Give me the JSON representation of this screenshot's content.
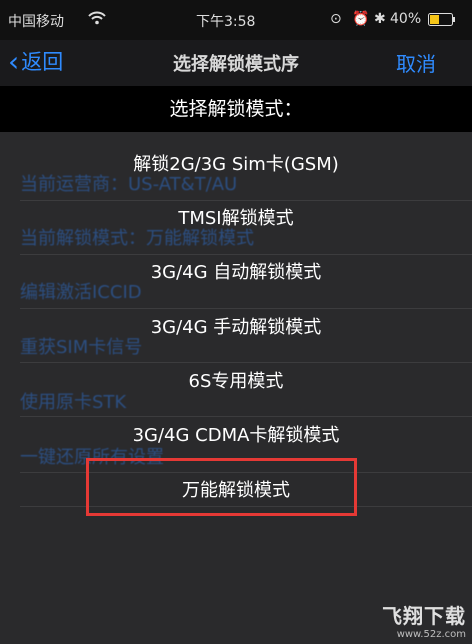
{
  "status_bar": {
    "carrier": "中国移动",
    "wifi_icon": "wifi-icon",
    "time": "下午3:58",
    "battery": "40%"
  },
  "nav": {
    "back_label": "返回",
    "title": "选择解锁模式序",
    "cancel_label": "取消"
  },
  "background_items": [
    {
      "label": "当前运营商：US-AT&T/AU"
    },
    {
      "label": "当前解锁模式：万能解锁模式"
    },
    {
      "label": "编辑激活ICCID"
    },
    {
      "label": "重获SIM卡信号"
    },
    {
      "label": "使用原卡STK"
    },
    {
      "label": "一键还原所有设置"
    }
  ],
  "sheet": {
    "header": "选择解锁模式：",
    "options": [
      {
        "label": "解锁2G/3G Sim卡(GSM)"
      },
      {
        "label": "TMSI解锁模式"
      },
      {
        "label": "3G/4G 自动解锁模式"
      },
      {
        "label": "3G/4G 手动解锁模式"
      },
      {
        "label": "6S专用模式"
      },
      {
        "label": "3G/4G CDMA卡解锁模式"
      },
      {
        "label": "万能解锁模式"
      }
    ]
  },
  "watermark": {
    "logo": "飞翔下载",
    "url": "www.52z.com"
  }
}
